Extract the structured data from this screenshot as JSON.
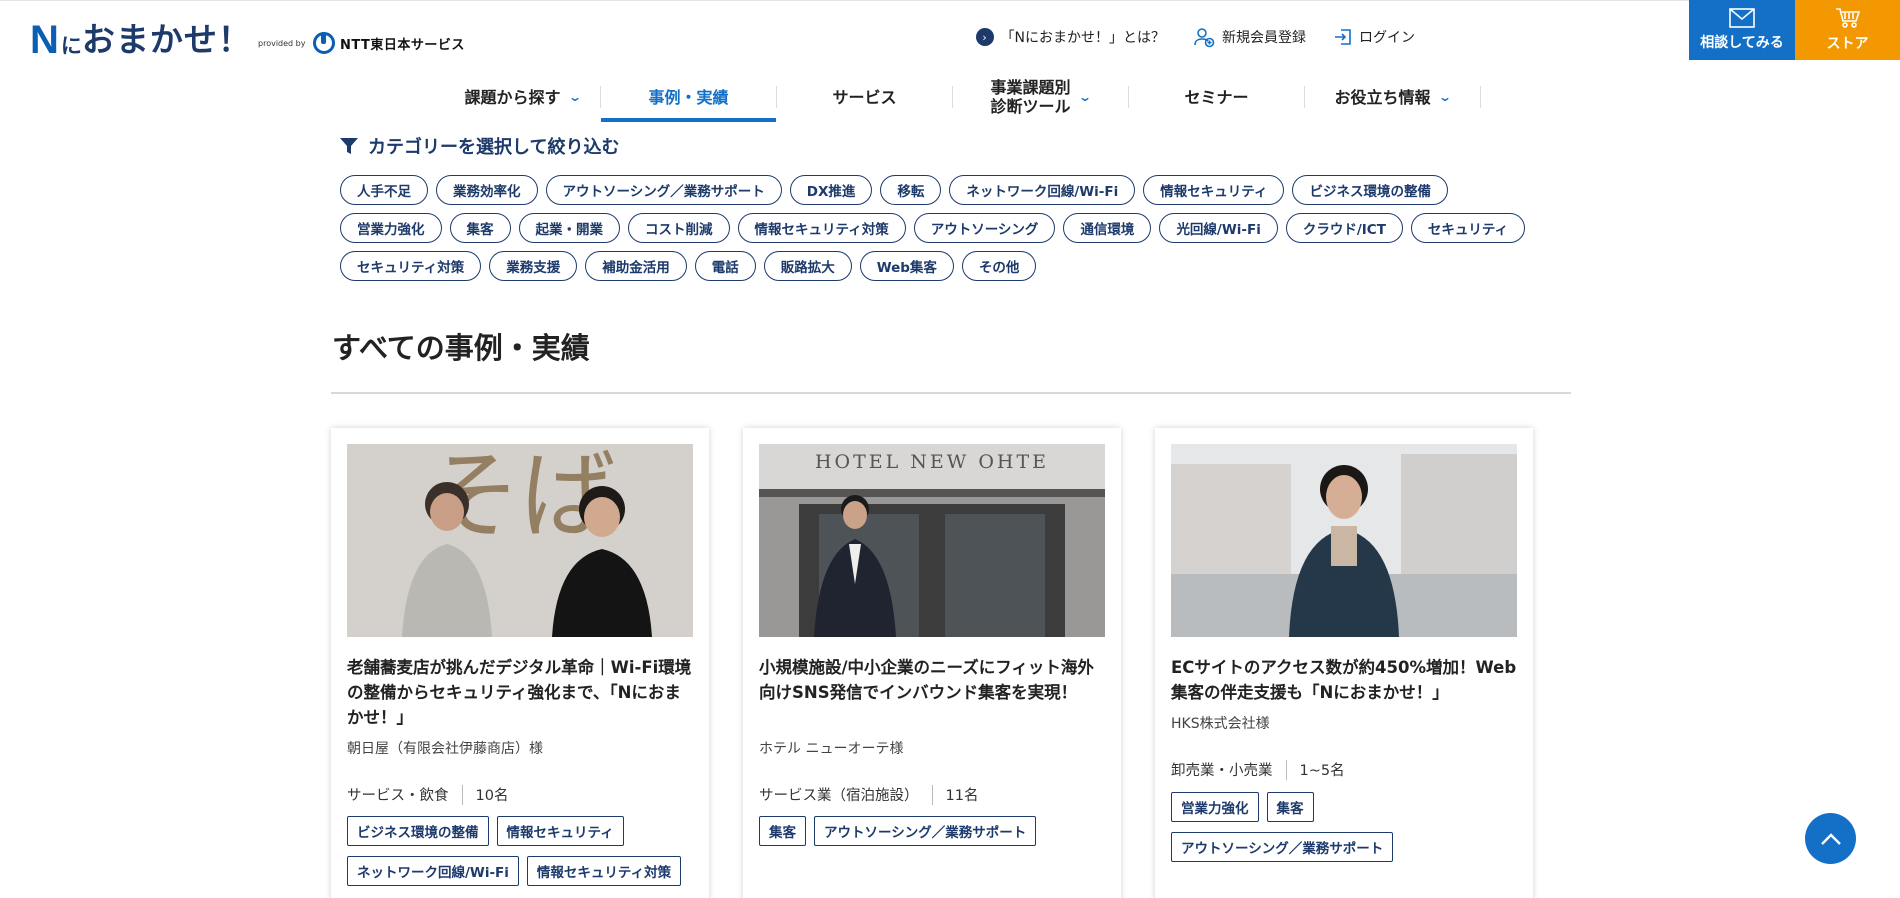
{
  "header": {
    "logo": {
      "n": "N",
      "ni": "に",
      "main": "おまかせ！",
      "provided": "provided by",
      "ntt": "NTT東日本サービス"
    },
    "links": {
      "about": "「Nにおまかせ！」とは？",
      "register": "新規会員登録",
      "login": "ログイン"
    },
    "consult_label": "相談してみる",
    "store_label": "ストア"
  },
  "nav": {
    "items": [
      {
        "label": "課題から探す",
        "chevron": true
      },
      {
        "label": "事例・実績",
        "active": true
      },
      {
        "label": "サービス"
      },
      {
        "label": "事業課題別",
        "label2": "診断ツール",
        "chevron": true
      },
      {
        "label": "セミナー"
      },
      {
        "label": "お役立ち情報",
        "chevron": true
      }
    ]
  },
  "filter": {
    "title": "カテゴリーを選択して絞り込む",
    "rows": [
      [
        "人手不足",
        "業務効率化",
        "アウトソーシング／業務サポート",
        "DX推進",
        "移転",
        "ネットワーク回線/Wi-Fi",
        "情報セキュリティ",
        "ビジネス環境の整備"
      ],
      [
        "営業力強化",
        "集客",
        "起業・開業",
        "コスト削減",
        "情報セキュリティ対策",
        "アウトソーシング",
        "通信環境",
        "光回線/Wi-Fi",
        "クラウド/ICT",
        "セキュリティ"
      ],
      [
        "セキュリティ対策",
        "業務支援",
        "補助金活用",
        "電話",
        "販路拡大",
        "Web集客",
        "その他"
      ]
    ]
  },
  "section": {
    "title": "すべての事例・実績"
  },
  "cards": [
    {
      "title": "老舗蕎麦店が挑んだデジタル革命｜Wi-Fi環境の整備からセキュリティ強化まで、「Nにおまかせ！」",
      "company": "朝日屋（有限会社伊藤商店）様",
      "industry": "サービス・飲食",
      "employees": "10名",
      "tags": [
        "ビジネス環境の整備",
        "情報セキュリティ",
        "ネットワーク回線/Wi-Fi",
        "情報セキュリティ対策"
      ],
      "image_sign": "そば"
    },
    {
      "title": "小規模施設/中小企業のニーズにフィット海外向けSNS発信でインバウンド集客を実現！",
      "company": "ホテル ニューオーテ様",
      "industry": "サービス業（宿泊施設）",
      "employees": "11名",
      "tags": [
        "集客",
        "アウトソーシング／業務サポート"
      ],
      "image_sign": "HOTEL NEW OHTE"
    },
    {
      "title": "ECサイトのアクセス数が約450%増加！Web集客の伴走支援も「Nにおまかせ！」",
      "company": "HKS株式会社様",
      "industry": "卸売業・小売業",
      "employees": "1~5名",
      "tags": [
        "営業力強化",
        "集客",
        "アウトソーシング／業務サポート"
      ]
    }
  ],
  "colors": {
    "primary": "#1470c7",
    "navy": "#1d3a6b",
    "orange": "#f39800"
  }
}
